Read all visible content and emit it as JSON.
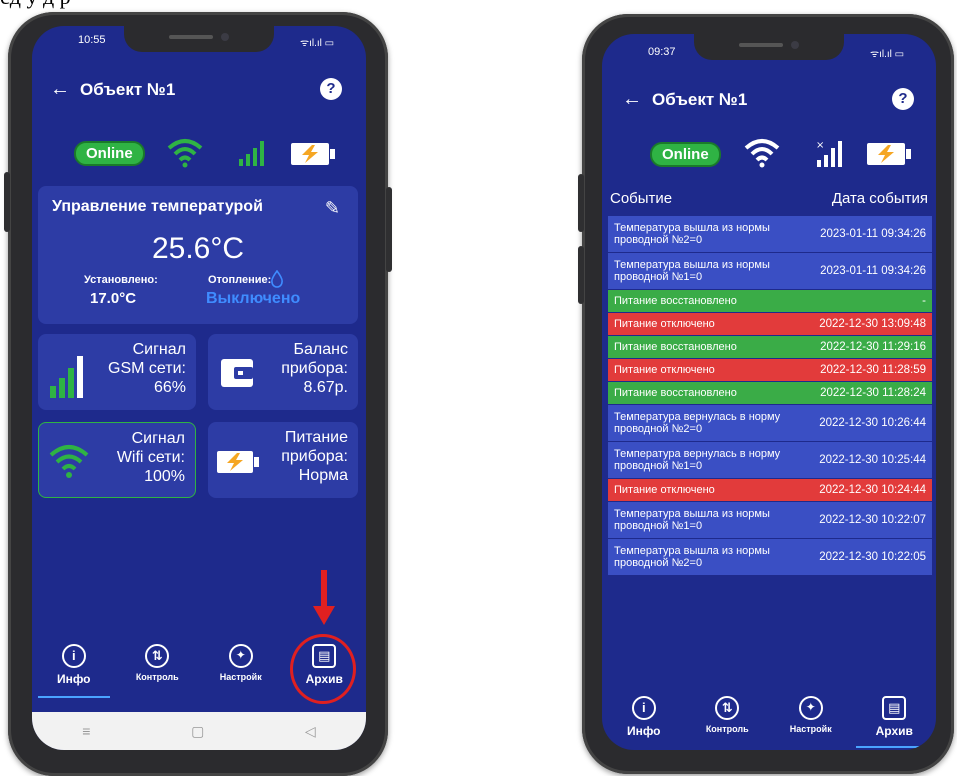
{
  "top_text": "сд    у д        р",
  "left_phone": {
    "status_time": "10:55",
    "status_right": "ᯤıl.ıl ▭",
    "title": "Объект №1",
    "help": "?",
    "online": "Online",
    "temp_card": {
      "title": "Управление температурой",
      "value": "25.6°C",
      "set_label": "Установлено:",
      "set_value": "17.0°C",
      "heat_label": "Отопление:",
      "heat_value": "Выключено"
    },
    "tiles": {
      "gsm": [
        "Сигнал",
        "GSM сети:",
        "66%"
      ],
      "balance": [
        "Баланс",
        "прибора:",
        "8.67р."
      ],
      "wifi": [
        "Сигнал",
        "Wifi сети:",
        "100%"
      ],
      "power": [
        "Питание",
        "прибора:",
        "Норма"
      ]
    },
    "nav": [
      "Инфо",
      "Контроль",
      "Настройк",
      "Архив"
    ],
    "active_nav": "Инфо"
  },
  "right_phone": {
    "status_time": "09:37",
    "status_right": "ᯤıl.ıl ▭",
    "title": "Объект №1",
    "help": "?",
    "online": "Online",
    "col_event": "Событие",
    "col_date": "Дата события",
    "rows": [
      {
        "event": "Температура вышла из нормы проводной №2=0",
        "date": "2023-01-11 09:34:26",
        "kind": "blue"
      },
      {
        "event": "Температура вышла из нормы проводной №1=0",
        "date": "2023-01-11 09:34:26",
        "kind": "blue"
      },
      {
        "event": "Питание восстановлено",
        "date": "-",
        "kind": "green"
      },
      {
        "event": "Питание отключено",
        "date": "2022-12-30 13:09:48",
        "kind": "red"
      },
      {
        "event": "Питание восстановлено",
        "date": "2022-12-30 11:29:16",
        "kind": "green"
      },
      {
        "event": "Питание отключено",
        "date": "2022-12-30 11:28:59",
        "kind": "red"
      },
      {
        "event": "Питание восстановлено",
        "date": "2022-12-30 11:28:24",
        "kind": "green"
      },
      {
        "event": "Температура вернулась в норму проводной №2=0",
        "date": "2022-12-30 10:26:44",
        "kind": "blue"
      },
      {
        "event": "Температура вернулась в норму проводной №1=0",
        "date": "2022-12-30 10:25:44",
        "kind": "blue"
      },
      {
        "event": "Питание отключено",
        "date": "2022-12-30 10:24:44",
        "kind": "red"
      },
      {
        "event": "Температура вышла из нормы проводной №1=0",
        "date": "2022-12-30 10:22:07",
        "kind": "blue"
      },
      {
        "event": "Температура вышла из нормы проводной №2=0",
        "date": "2022-12-30 10:22:05",
        "kind": "blue"
      }
    ],
    "nav": [
      "Инфо",
      "Контроль",
      "Настройк",
      "Архив"
    ],
    "active_nav": "Архив"
  },
  "colors": {
    "screen_bg": "#1e2a8c",
    "card_bg": "#2d3ca5",
    "online_green": "#2fb344",
    "row_blue": "#3a4fc4",
    "row_green": "#3aac47",
    "row_red": "#e23b3b",
    "highlight_red": "#e02020"
  },
  "icons": {
    "back": "←",
    "pencil": "✎",
    "info": "i",
    "control": "⇅",
    "settings": "🔧",
    "archive": "▤"
  }
}
